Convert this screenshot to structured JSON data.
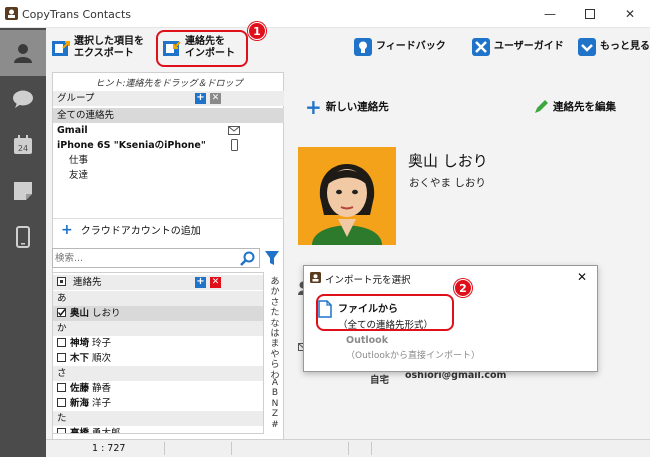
{
  "window": {
    "title": "CopyTrans Contacts"
  },
  "toolbar": {
    "export_label": "選択した項目を\nエクスポート",
    "import_label": "連絡先を\nインポート",
    "feedback_label": "フィードバック",
    "guide_label": "ユーザーガイド",
    "more_label": "もっと見る"
  },
  "badges": {
    "one": "1",
    "two": "2"
  },
  "left": {
    "hint": "ヒント:連絡先をドラッグ＆ドロップ",
    "group_header": "グループ",
    "groups": [
      {
        "label": "全ての連絡先"
      },
      {
        "label": "Gmail"
      },
      {
        "label": "iPhone 6S \"KseniaのiPhone\""
      },
      {
        "label": "仕事"
      },
      {
        "label": "友達"
      }
    ],
    "cloud_add": "クラウドアカウントの追加",
    "search_placeholder": "検索...",
    "contacts_header": "連絡先",
    "contacts": [
      {
        "kind": "section",
        "label": "あ"
      },
      {
        "kind": "item",
        "surname": "奥山",
        "given": "しおり",
        "checked": true
      },
      {
        "kind": "section",
        "label": "か"
      },
      {
        "kind": "item",
        "surname": "神埼",
        "given": "玲子",
        "checked": false
      },
      {
        "kind": "item",
        "surname": "木下",
        "given": "順次",
        "checked": false
      },
      {
        "kind": "section",
        "label": "さ"
      },
      {
        "kind": "item",
        "surname": "佐藤",
        "given": "静香",
        "checked": false
      },
      {
        "kind": "item",
        "surname": "新海",
        "given": "洋子",
        "checked": false
      },
      {
        "kind": "section",
        "label": "た"
      },
      {
        "kind": "item",
        "surname": "高橋",
        "given": "勇太郎",
        "checked": false
      }
    ],
    "alphabet": [
      "あ",
      "か",
      "さ",
      "た",
      "な",
      "は",
      "ま",
      "や",
      "ら",
      "わ",
      "A",
      "B",
      "N",
      "Z",
      "#"
    ]
  },
  "main": {
    "new_contact": "新しい連絡先",
    "edit_contact": "連絡先を編集",
    "contact_name": "奥山 しおり",
    "contact_reading": "おくやま しおり",
    "field_label": "自宅",
    "field_value": "oshiori@gmail.com"
  },
  "dialog": {
    "title": "インポート元を選択",
    "option1_title": "ファイルから",
    "option1_sub": "（全ての連絡先形式）",
    "option2_title": "Outlook",
    "option2_sub": "（Outlookから直接インポート）"
  },
  "status": {
    "count": "1 : 727"
  },
  "colors": {
    "accent": "#1f73c9",
    "highlight": "#e0101a",
    "rail": "#4b4b4b"
  }
}
